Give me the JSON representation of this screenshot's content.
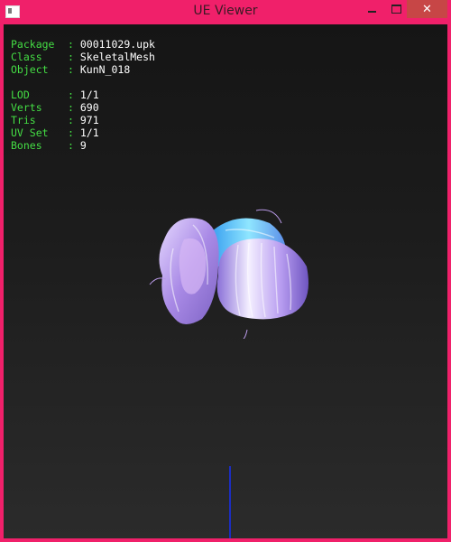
{
  "window": {
    "title": "UE Viewer",
    "close_glyph": "✕"
  },
  "info": {
    "package": {
      "label": "Package",
      "value": "00011029.upk"
    },
    "class": {
      "label": "Class",
      "value": "SkeletalMesh"
    },
    "object": {
      "label": "Object",
      "value": "KunN_018"
    },
    "lod": {
      "label": "LOD",
      "value": "1/1"
    },
    "verts": {
      "label": "Verts",
      "value": "690"
    },
    "tris": {
      "label": "Tris",
      "value": "971"
    },
    "uvset": {
      "label": "UV Set",
      "value": "1/1"
    },
    "bones": {
      "label": "Bones",
      "value": "9"
    }
  },
  "colors": {
    "frame": "#f0206a",
    "label": "#44dd44",
    "value": "#ffffff",
    "axis": "#1b2dc2"
  }
}
